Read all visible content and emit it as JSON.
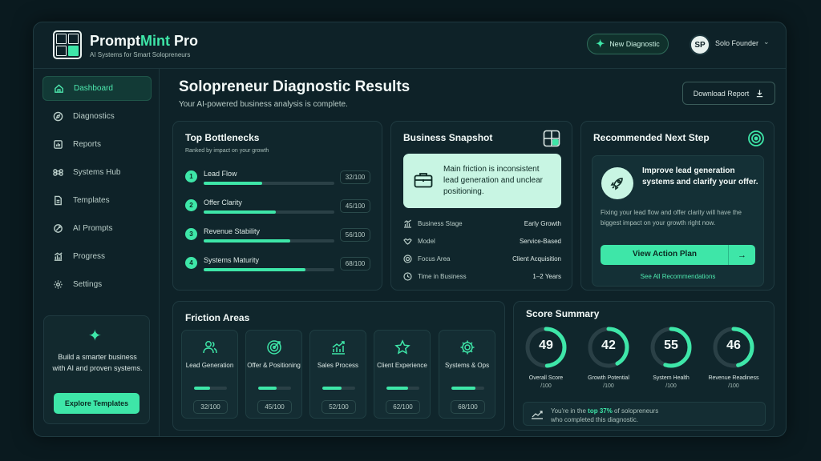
{
  "header": {
    "brand_main": "Prompt",
    "brand_accent": "Mint",
    "brand_suffix": " Pro",
    "tagline": "AI Systems for Smart Solopreneurs",
    "new_diagnostic": "New Diagnostic",
    "avatar_initials": "SP",
    "user_name": "Solo Founder"
  },
  "sidebar": {
    "items": [
      {
        "label": "Dashboard",
        "icon": "home-icon"
      },
      {
        "label": "Diagnostics",
        "icon": "compass-icon"
      },
      {
        "label": "Reports",
        "icon": "report-icon"
      },
      {
        "label": "Systems Hub",
        "icon": "command-icon"
      },
      {
        "label": "Templates",
        "icon": "document-icon"
      },
      {
        "label": "AI Prompts",
        "icon": "ai-prompt-icon"
      },
      {
        "label": "Progress",
        "icon": "progress-chart-icon"
      },
      {
        "label": "Settings",
        "icon": "gear-icon"
      }
    ],
    "promo_text": "Build a smarter business with AI and proven systems.",
    "promo_button": "Explore Templates"
  },
  "main": {
    "title": "Solopreneur Diagnostic Results",
    "subtitle": "Your AI-powered business analysis is complete.",
    "download": "Download Report"
  },
  "bottlenecks": {
    "title": "Top Bottlenecks",
    "subtitle": "Ranked by impact on your growth",
    "items": [
      {
        "rank": "1",
        "label": "Lead Flow",
        "score": "32/100",
        "progress": 0.45
      },
      {
        "rank": "2",
        "label": "Offer Clarity",
        "score": "45/100",
        "progress": 0.55
      },
      {
        "rank": "3",
        "label": "Revenue Stability",
        "score": "56/100",
        "progress": 0.66
      },
      {
        "rank": "4",
        "label": "Systems Maturity",
        "score": "68/100",
        "progress": 0.78
      }
    ]
  },
  "snapshot": {
    "title": "Business Snapshot",
    "friction": "Main friction is inconsistent lead generation and unclear positioning.",
    "rows": [
      {
        "key": "Business Stage",
        "value": "Early Growth",
        "icon": "bar-chart-icon"
      },
      {
        "key": "Model",
        "value": "Service-Based",
        "icon": "handshake-icon"
      },
      {
        "key": "Focus Area",
        "value": "Client Acquisition",
        "icon": "target-icon"
      },
      {
        "key": "Time in Business",
        "value": "1–2 Years",
        "icon": "clock-icon"
      }
    ]
  },
  "recommend": {
    "title": "Recommended Next Step",
    "headline": "Improve lead generation systems and clarify your offer.",
    "description": "Fixing your lead flow and offer clarity will have the biggest impact on your growth right now.",
    "button": "View Action Plan",
    "link": "See All Recommendations"
  },
  "friction": {
    "title": "Friction Areas",
    "items": [
      {
        "label": "Lead Generation",
        "score": "32/100",
        "progress": 0.48,
        "icon": "users-icon"
      },
      {
        "label": "Offer & Positioning",
        "score": "45/100",
        "progress": 0.55,
        "icon": "target-icon"
      },
      {
        "label": "Sales Process",
        "score": "52/100",
        "progress": 0.58,
        "icon": "trend-up-icon"
      },
      {
        "label": "Client Experience",
        "score": "62/100",
        "progress": 0.66,
        "icon": "star-icon"
      },
      {
        "label": "Systems & Ops",
        "score": "68/100",
        "progress": 0.72,
        "icon": "gear-icon"
      }
    ]
  },
  "score_summary": {
    "title": "Score Summary",
    "gauges": [
      {
        "value": 49,
        "label": "Overall Score",
        "max": "/100"
      },
      {
        "value": 42,
        "label": "Growth Potential",
        "max": "/100"
      },
      {
        "value": 55,
        "label": "System Health",
        "max": "/100"
      },
      {
        "value": 46,
        "label": "Revenue Readiness",
        "max": "/100"
      }
    ],
    "foot_pre": "You're in the ",
    "foot_hl": "top 37%",
    "foot_post": " of solopreneurs",
    "foot_line2": "who completed this diagnostic."
  },
  "colors": {
    "accent": "#3ee6a8",
    "background": "#0e2228"
  }
}
